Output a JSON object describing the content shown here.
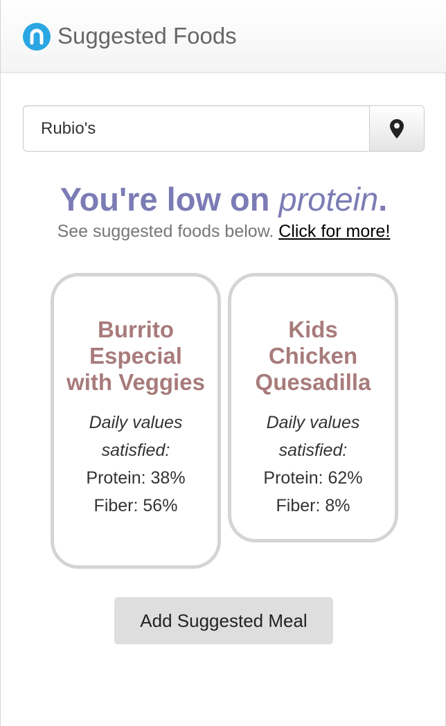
{
  "header": {
    "title": "Suggested Foods",
    "logo_letter": "n",
    "logo_color": "#2aa6e2"
  },
  "search": {
    "value": "Rubio's",
    "location_icon": "map-pin-icon"
  },
  "alert": {
    "prefix": "You're low on ",
    "nutrient": "protein",
    "suffix": ".",
    "subtext": "See suggested foods below.",
    "more_link": "Click for more!"
  },
  "suggestions": [
    {
      "name": "Burrito Especial with Veggies",
      "dv_label": "Daily values satisfied:",
      "nutrients": [
        "Protein: 38%",
        "Fiber: 56%"
      ]
    },
    {
      "name": "Kids Chicken Quesadilla",
      "dv_label": "Daily values satisfied:",
      "nutrients": [
        "Protein: 62%",
        "Fiber: 8%"
      ]
    }
  ],
  "add_button": "Add Suggested Meal",
  "colors": {
    "headline": "#7b7bb5",
    "food_name": "#a87b7b",
    "card_border": "#d4d4d4"
  }
}
